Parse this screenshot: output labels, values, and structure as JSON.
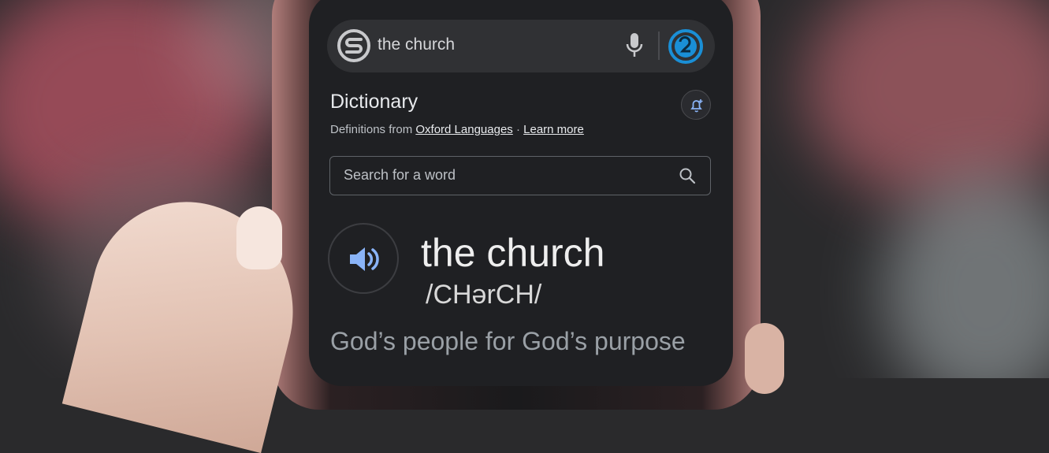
{
  "search": {
    "query": "the church"
  },
  "dictionary": {
    "title": "Dictionary",
    "source_prefix": "Definitions from",
    "source_link": "Oxford Languages",
    "separator": "·",
    "learn_more": "Learn more",
    "search_placeholder": "Search for a word"
  },
  "entry": {
    "word": "the church",
    "phonetic": "/CHərCH/",
    "definition": "God’s people for God’s purpose"
  },
  "colors": {
    "screen_bg": "#1f2023",
    "searchbar_bg": "#303134",
    "speaker_accent": "#8ab4f8",
    "avatar_accent": "#1a8fd6"
  },
  "icons": [
    "church-logo-icon",
    "mic-icon",
    "avatar",
    "bell-plus-icon",
    "search-icon",
    "speaker-icon"
  ]
}
